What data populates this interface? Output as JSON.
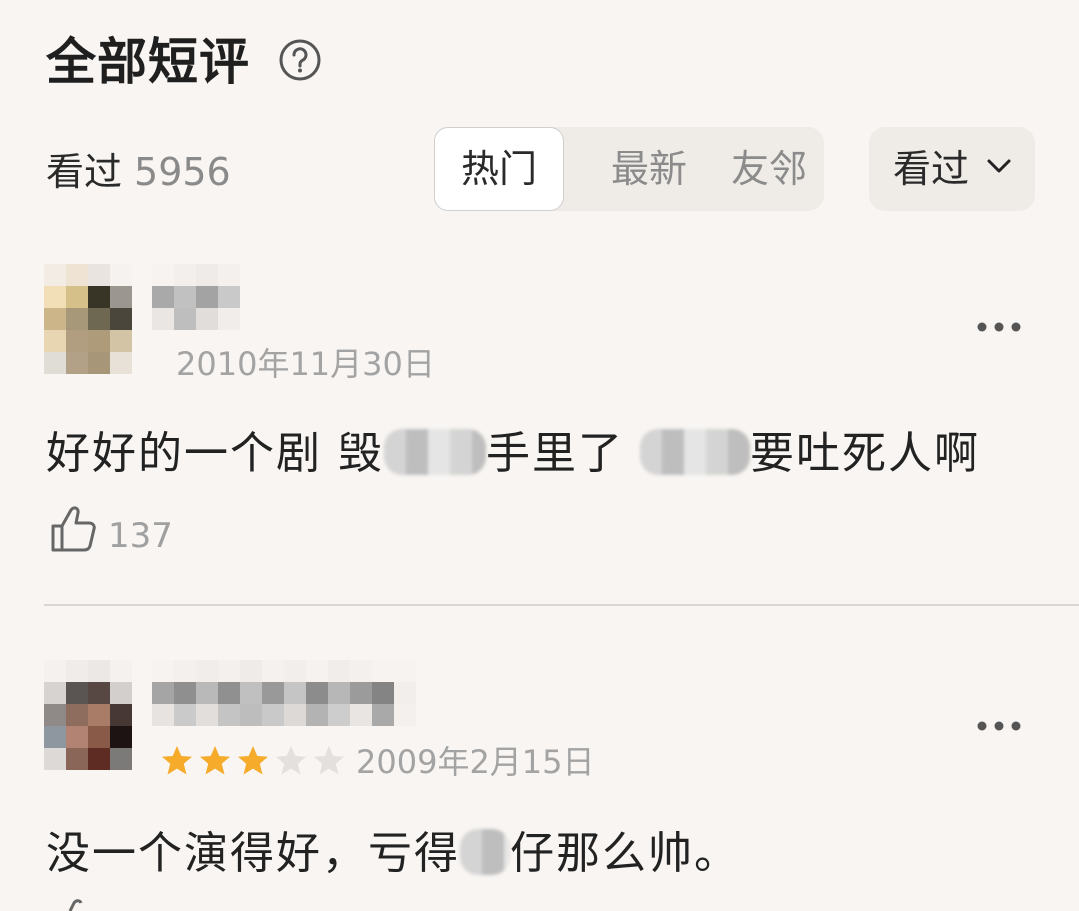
{
  "header": {
    "title": "全部短评",
    "help_icon": "question-circle-icon"
  },
  "toolbar": {
    "watched_label": "看过",
    "watched_count": "5956",
    "tabs": [
      "热门",
      "最新",
      "友邻"
    ],
    "active_tab": "热门",
    "filter_label": "看过",
    "filter_icon": "chevron-down-icon"
  },
  "comments": [
    {
      "date": "2010年11月30日",
      "text_parts": [
        "好好的一个剧 毁",
        "手里了",
        "要吐死人啊"
      ],
      "likes": "137",
      "rating_stars": null
    },
    {
      "date": "2009年2月15日",
      "text_parts": [
        "没一个演得好，亏得",
        "仔那么帅。"
      ],
      "rating_stars": 3,
      "rating_max": 5
    }
  ],
  "colors": {
    "background": "#f8f5f2",
    "star_filled": "#f6ab2a",
    "star_empty": "#e3e0dd",
    "muted_text": "#a3a3a3"
  }
}
